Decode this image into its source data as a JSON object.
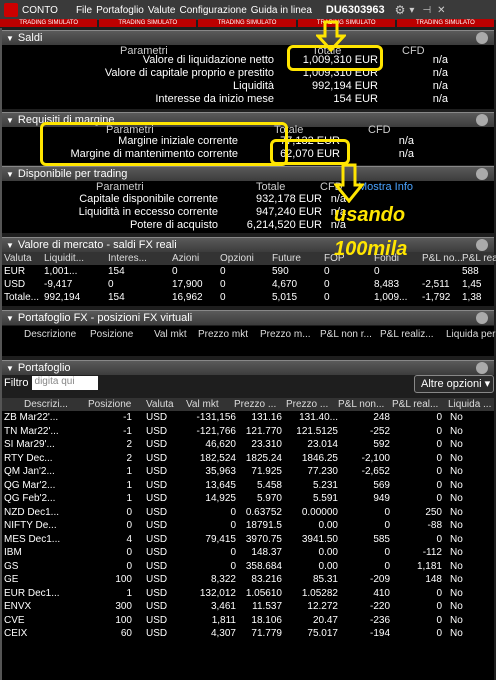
{
  "menu": {
    "account": "CONTO",
    "items": [
      "File",
      "Portafoglio",
      "Valute",
      "Configurazione",
      "Guida in linea"
    ],
    "account_id": "DU6303963"
  },
  "sim_labels": [
    "TRADING SIMULATO",
    "TRADING SIMULATO",
    "TRADING SIMULATO",
    "TRADING SIMULATO",
    "TRADING SIMULATO"
  ],
  "saldi": {
    "title": "Saldi",
    "col_param": "Parametri",
    "col_totale": "Totale",
    "col_cfd": "CFD",
    "rows": [
      {
        "label": "Valore di liquidazione netto",
        "total": "1,009,310 EUR",
        "cfd": "n/a"
      },
      {
        "label": "Valore di capitale proprio e prestito",
        "total": "1,009,310 EUR",
        "cfd": "n/a"
      },
      {
        "label": "Liquidità",
        "total": "992,194 EUR",
        "cfd": "n/a"
      },
      {
        "label": "Interesse da inizio mese",
        "total": "154 EUR",
        "cfd": "n/a"
      }
    ]
  },
  "margine": {
    "title": "Requisiti di margine",
    "col_param": "Parametri",
    "col_totale": "Totale",
    "col_cfd": "CFD",
    "rows": [
      {
        "label": "Margine iniziale corrente",
        "total": "77,132 EUR",
        "cfd": "n/a"
      },
      {
        "label": "Margine di mantenimento corrente",
        "total": "62,070 EUR",
        "cfd": "n/a"
      }
    ]
  },
  "disponibile": {
    "title": "Disponibile per trading",
    "col_param": "Parametri",
    "col_totale": "Totale",
    "col_cfd": "CFD",
    "mix": "Mostra Info",
    "rows": [
      {
        "label": "Capitale disponibile corrente",
        "total": "932,178 EUR",
        "cfd": "n/a"
      },
      {
        "label": "Liquidità in eccesso corrente",
        "total": "947,240 EUR",
        "cfd": "n/a"
      },
      {
        "label": "Potere di acquisto",
        "total": "6,214,520 EUR",
        "cfd": "n/a"
      }
    ]
  },
  "annotation": {
    "line1": "usando",
    "line2": "100mila"
  },
  "mercato": {
    "title": "Valore di mercato - saldi FX reali",
    "headers": [
      "Valuta",
      "Liquidit...",
      "Interes...",
      "Azioni",
      "Opzioni",
      "Future",
      "FOP",
      "Fondi",
      "Val. mk",
      "P&L no...",
      "P&L rea"
    ],
    "rows": [
      [
        "EUR",
        "1,001...",
        "154",
        "0",
        "0",
        "590",
        "0",
        "0",
        "",
        "588",
        ""
      ],
      [
        "USD",
        "-9,417",
        "0",
        "17,900",
        "0",
        "4,670",
        "0",
        "8,483",
        "-2,511",
        "1,45",
        ""
      ],
      [
        "Totale...",
        "992,194",
        "154",
        "16,962",
        "0",
        "5,015",
        "0",
        "1,009...",
        "-1,792",
        "1,38",
        ""
      ]
    ]
  },
  "fx": {
    "title": "Portafoglio FX - posizioni FX virtuali",
    "headers": [
      "Descrizione",
      "Posizione",
      "Val mkt",
      "Prezzo mkt",
      "Prezzo m...",
      "P&L non r...",
      "P&L realiz...",
      "Liquida per"
    ]
  },
  "portafoglio": {
    "title": "Portafoglio",
    "filter_label": "Filtro",
    "filter_placeholder": "digita qui",
    "more": "Altre opzioni",
    "headers": [
      "Descrizi...",
      "Posizione",
      "Valuta",
      "Val mkt",
      "Prezzo ...",
      "Prezzo ...",
      "P&L non...",
      "P&L real...",
      "Liquida ..."
    ],
    "rows": [
      [
        "ZB Mar22'...",
        "-1",
        "USD",
        "-131,156",
        "131.16",
        "131.40...",
        "248",
        "0",
        "No"
      ],
      [
        "TN Mar22'...",
        "-1",
        "USD",
        "-121,766",
        "121.770",
        "121.5125",
        "-252",
        "0",
        "No"
      ],
      [
        "SI Mar29'...",
        "2",
        "USD",
        "46,620",
        "23.310",
        "23.014",
        "592",
        "0",
        "No"
      ],
      [
        "RTY Dec...",
        "2",
        "USD",
        "182,524",
        "1825.24",
        "1846.25",
        "-2,100",
        "0",
        "No"
      ],
      [
        "QM Jan'2...",
        "1",
        "USD",
        "35,963",
        "71.925",
        "77.230",
        "-2,652",
        "0",
        "No"
      ],
      [
        "QG Mar'2...",
        "1",
        "USD",
        "13,645",
        "5.458",
        "5.231",
        "569",
        "0",
        "No"
      ],
      [
        "QG Feb'2...",
        "1",
        "USD",
        "14,925",
        "5.970",
        "5.591",
        "949",
        "0",
        "No"
      ],
      [
        "NZD Dec1...",
        "0",
        "USD",
        "0",
        "0.63752",
        "0.00000",
        "0",
        "250",
        "No"
      ],
      [
        "NIFTY De...",
        "0",
        "USD",
        "0",
        "18791.5",
        "0.00",
        "0",
        "-88",
        "No"
      ],
      [
        "MES Dec1...",
        "4",
        "USD",
        "79,415",
        "3970.75",
        "3941.50",
        "585",
        "0",
        "No"
      ],
      [
        "IBM",
        "0",
        "USD",
        "0",
        "148.37",
        "0.00",
        "0",
        "-112",
        "No"
      ],
      [
        "GS",
        "0",
        "USD",
        "0",
        "358.684",
        "0.00",
        "0",
        "1,181",
        "No"
      ],
      [
        "GE",
        "100",
        "USD",
        "8,322",
        "83.216",
        "85.31",
        "-209",
        "148",
        "No"
      ],
      [
        "EUR Dec1...",
        "1",
        "USD",
        "132,012",
        "1.05610",
        "1.05282",
        "410",
        "0",
        "No"
      ],
      [
        "ENVX",
        "300",
        "USD",
        "3,461",
        "11.537",
        "12.272",
        "-220",
        "0",
        "No"
      ],
      [
        "CVE",
        "100",
        "USD",
        "1,811",
        "18.106",
        "20.47",
        "-236",
        "0",
        "No"
      ],
      [
        "CEIX",
        "60",
        "USD",
        "4,307",
        "71.779",
        "75.017",
        "-194",
        "0",
        "No"
      ]
    ]
  }
}
